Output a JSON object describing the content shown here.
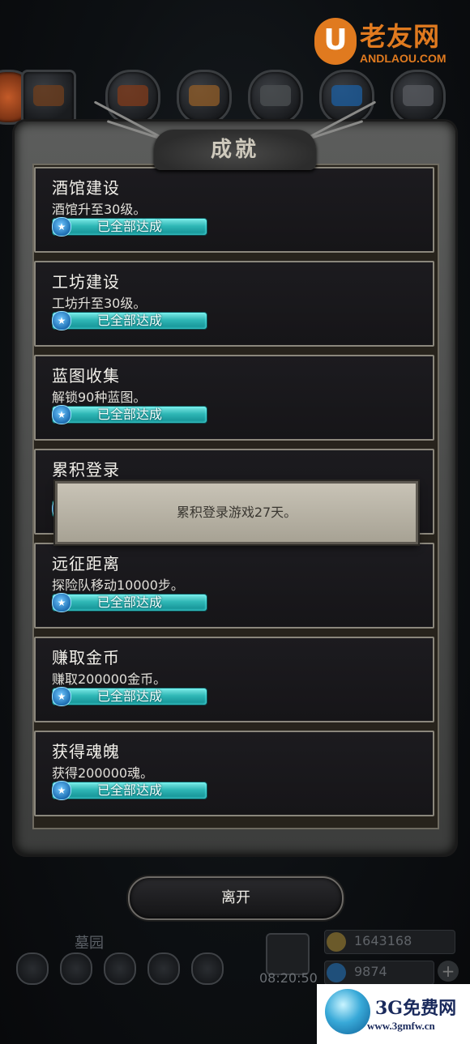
{
  "watermark_top": {
    "logo_letter": "U",
    "text": "老友网",
    "domain": "ANDLAOU.COM",
    "color": "#e07a1f"
  },
  "panel": {
    "title": "成就"
  },
  "achievements": [
    {
      "name": "酒馆建设",
      "desc": "酒馆升至30级。",
      "status": "已全部达成"
    },
    {
      "name": "工坊建设",
      "desc": "工坊升至30级。",
      "status": "已全部达成"
    },
    {
      "name": "蓝图收集",
      "desc": "解锁90种蓝图。",
      "status": "已全部达成"
    },
    {
      "name": "累积登录",
      "desc": "",
      "status": ""
    },
    {
      "name": "远征距离",
      "desc": "探险队移动10000步。",
      "status": "已全部达成"
    },
    {
      "name": "赚取金币",
      "desc": "赚取200000金币。",
      "status": "已全部达成"
    },
    {
      "name": "获得魂魄",
      "desc": "获得200000魂。",
      "status": "已全部达成"
    }
  ],
  "tooltip": {
    "text": "累积登录游戏27天。"
  },
  "leave_button": {
    "label": "离开"
  },
  "hud": {
    "location_label": "墓园",
    "clock": "08:20:50",
    "gold": "1643168",
    "souls": "9874",
    "plus_icon": "+"
  },
  "watermark_bottom": {
    "text": "3G免费网",
    "domain": "www.3gmfw.cn"
  },
  "colors": {
    "accent_bar": "#2fb7b6",
    "card_bg": "#1c1b1f",
    "card_border": "#8b877c"
  }
}
